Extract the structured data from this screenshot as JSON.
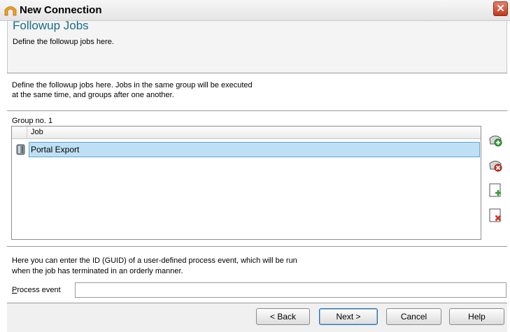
{
  "window": {
    "title": "New Connection",
    "icon": "app-logo-icon",
    "close_icon": "close-icon"
  },
  "header": {
    "title": "Followup Jobs",
    "subtitle": "Define the followup jobs here."
  },
  "description": {
    "line1": "Define the followup jobs here. Jobs in the same group will be executed",
    "line2": "at the same time, and groups after one another."
  },
  "group": {
    "label": "Group no. 1",
    "column_header": "Job",
    "rows": [
      {
        "icon": "job-icon",
        "job": "Portal Export",
        "selected": true
      }
    ]
  },
  "side_buttons": [
    {
      "name": "add-group-icon"
    },
    {
      "name": "remove-group-icon"
    },
    {
      "name": "add-job-icon"
    },
    {
      "name": "remove-job-icon"
    }
  ],
  "process": {
    "info_line1": "Here you can enter the ID (GUID) of a user-defined process event, which will be run",
    "info_line2": "when the job has terminated in an orderly manner.",
    "label_accel": "P",
    "label_rest": "rocess event",
    "value": ""
  },
  "buttons": {
    "back": "< Back",
    "next": "Next >",
    "cancel": "Cancel",
    "help": "Help"
  },
  "colors": {
    "header_title": "#1a6b8c",
    "selection": "#bfe0f4",
    "close": "#c3381d"
  }
}
